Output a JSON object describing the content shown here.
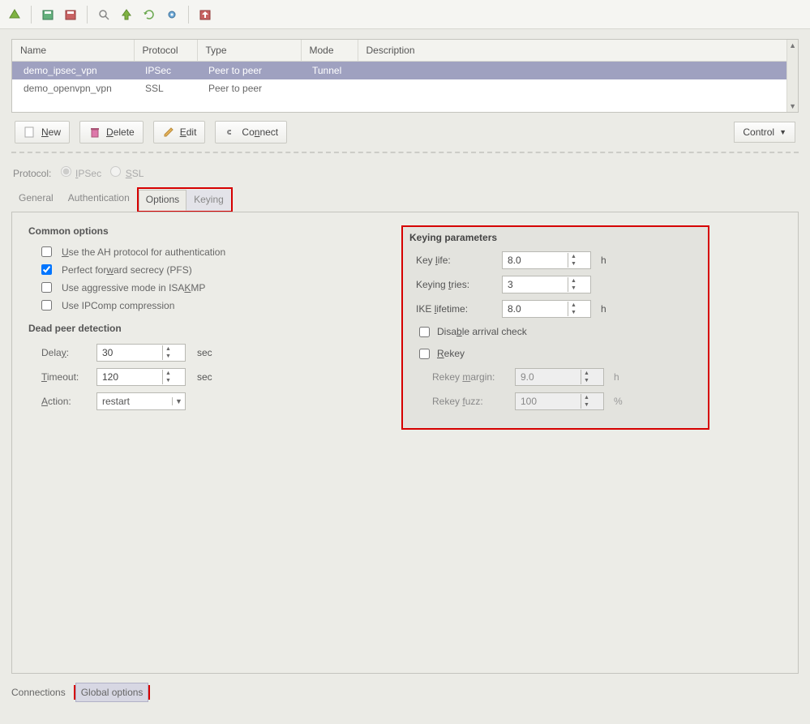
{
  "table": {
    "headers": [
      "Name",
      "Protocol",
      "Type",
      "Mode",
      "Description"
    ],
    "rows": [
      {
        "name": "demo_ipsec_vpn",
        "protocol": "IPSec",
        "type": "Peer to peer",
        "mode": "Tunnel",
        "description": "",
        "selected": true
      },
      {
        "name": "demo_openvpn_vpn",
        "protocol": "SSL",
        "type": "Peer to peer",
        "mode": "",
        "description": "",
        "selected": false
      }
    ]
  },
  "buttons": {
    "new": "New",
    "delete": "Delete",
    "edit": "Edit",
    "connect": "Connect",
    "control": "Control"
  },
  "protocol": {
    "label": "Protocol:",
    "ipsec": "IPSec",
    "ssl": "SSL",
    "selected": "ipsec"
  },
  "tabs": {
    "general": "General",
    "authentication": "Authentication",
    "options": "Options",
    "keying": "Keying"
  },
  "common": {
    "title": "Common options",
    "ah": "Use the AH protocol for authentication",
    "pfs": "Perfect forward secrecy (PFS)",
    "aggressive": "Use aggressive mode in ISAKMP",
    "ipcomp": "Use IPComp compression",
    "pfs_checked": true
  },
  "dpd": {
    "title": "Dead peer detection",
    "delay_label": "Delay:",
    "delay_val": "30",
    "delay_unit": "sec",
    "timeout_label": "Timeout:",
    "timeout_val": "120",
    "timeout_unit": "sec",
    "action_label": "Action:",
    "action_val": "restart"
  },
  "keying": {
    "title": "Keying parameters",
    "keylife_label": "Key life:",
    "keylife_val": "8.0",
    "keylife_unit": "h",
    "tries_label": "Keying tries:",
    "tries_val": "3",
    "ike_label": "IKE lifetime:",
    "ike_val": "8.0",
    "ike_unit": "h",
    "disable_arrival": "Disable arrival check",
    "rekey": "Rekey",
    "rekey_margin_label": "Rekey margin:",
    "rekey_margin_val": "9.0",
    "rekey_margin_unit": "h",
    "rekey_fuzz_label": "Rekey fuzz:",
    "rekey_fuzz_val": "100",
    "rekey_fuzz_unit": "%"
  },
  "bottom_tabs": {
    "connections": "Connections",
    "global": "Global options"
  }
}
